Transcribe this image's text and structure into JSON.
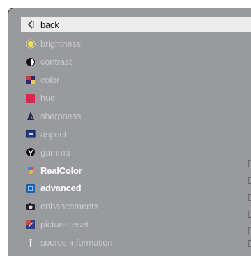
{
  "menu": {
    "items": [
      {
        "label": "back",
        "icon": "back-arrow-icon"
      },
      {
        "label": "brightness",
        "icon": "brightness-icon"
      },
      {
        "label": "contrast",
        "icon": "contrast-icon"
      },
      {
        "label": "color",
        "icon": "color-icon"
      },
      {
        "label": "hue",
        "icon": "hue-icon"
      },
      {
        "label": "sharpness",
        "icon": "sharpness-icon"
      },
      {
        "label": "aspect",
        "icon": "aspect-icon"
      },
      {
        "label": "gamma",
        "icon": "gamma-icon"
      },
      {
        "label": "RealColor",
        "icon": "realcolor-icon"
      },
      {
        "label": "advanced",
        "icon": "advanced-icon"
      },
      {
        "label": "enhancements",
        "icon": "enhancements-icon"
      },
      {
        "label": "picture reset",
        "icon": "picture-reset-icon"
      },
      {
        "label": "source information",
        "icon": "info-icon"
      }
    ]
  },
  "colors": {
    "panel": "#999a9e",
    "highlight": "#ececec",
    "dim_text": "#c8c9cd",
    "active_text": "#ffffff"
  }
}
